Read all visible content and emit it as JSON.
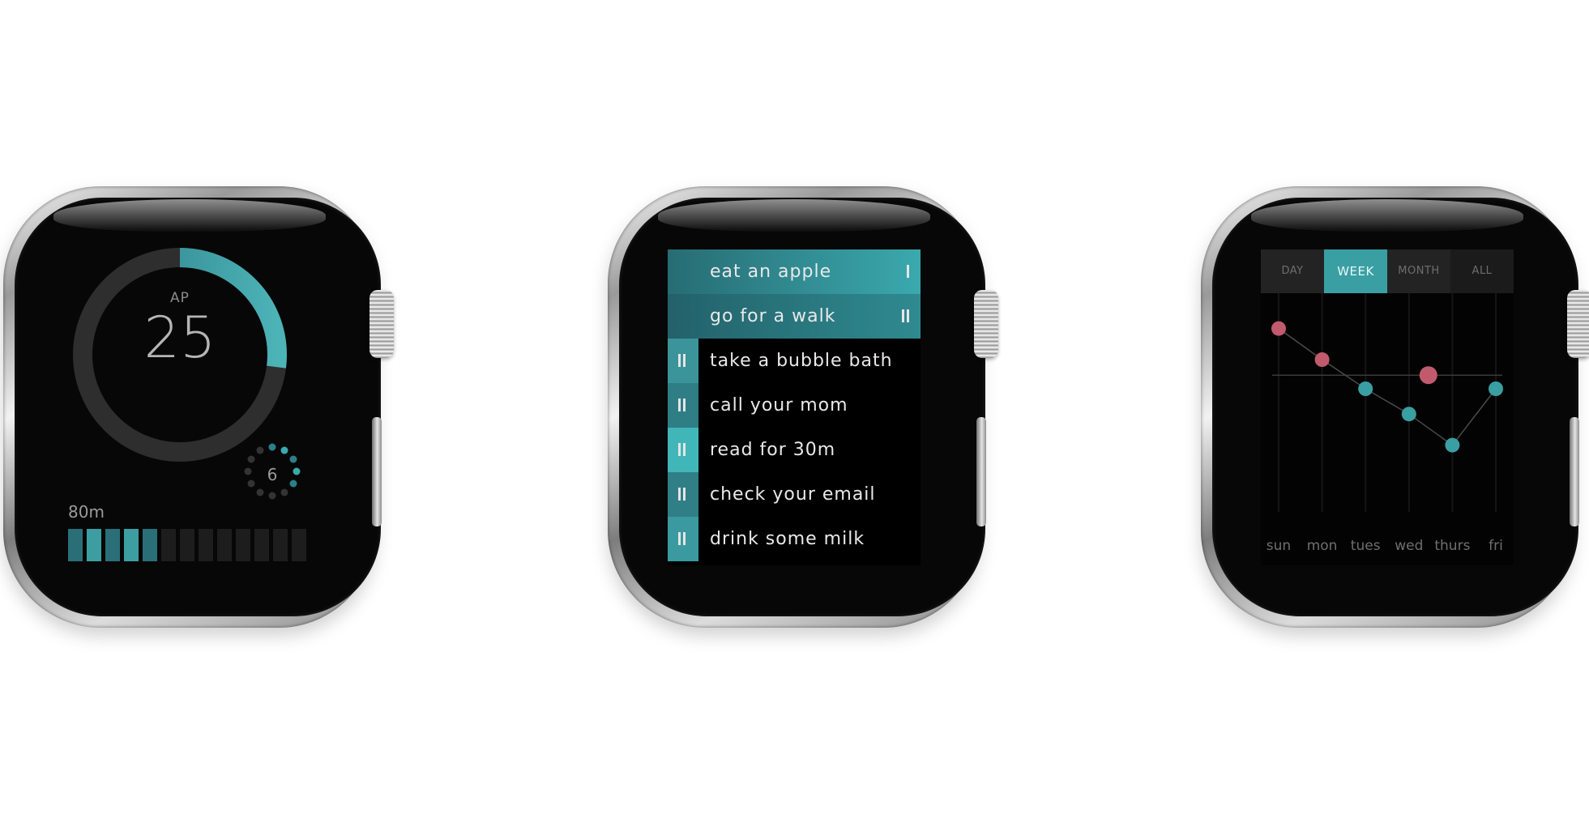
{
  "colors": {
    "accent": "#3a9fa3",
    "accent_dark": "#26707a",
    "pink": "#c25a6e",
    "track": "#2e2e2e",
    "text": "#e9e9e9",
    "muted": "#7a7a7a"
  },
  "watch_timer": {
    "ring_label": "AP",
    "ring_value": "25",
    "ring_progress": 0.27,
    "small_count": "6",
    "small_dots_active": 5,
    "small_dots_total": 12,
    "minutes_label": "80m",
    "bars_filled": 5,
    "bars_total": 13
  },
  "watch_tasks": {
    "tasks": [
      {
        "label": "eat an apple",
        "state": "active",
        "control": "single-bar-icon"
      },
      {
        "label": "go for a walk",
        "state": "active",
        "control": "pause-icon"
      },
      {
        "label": "take a bubble bath",
        "state": "idle"
      },
      {
        "label": "call your mom",
        "state": "idle"
      },
      {
        "label": "read for 30m",
        "state": "idle"
      },
      {
        "label": "check your email",
        "state": "idle"
      },
      {
        "label": "drink some milk",
        "state": "idle"
      }
    ]
  },
  "watch_stats": {
    "segments": [
      {
        "label": "DAY",
        "selected": false
      },
      {
        "label": "WEEK",
        "selected": true
      },
      {
        "label": "MONTH",
        "selected": false
      },
      {
        "label": "ALL",
        "selected": false
      }
    ],
    "chart_data": {
      "type": "scatter",
      "x": [
        "sun",
        "mon",
        "tues",
        "wed",
        "thurs",
        "fri"
      ],
      "line_series": [
        {
          "x": "sun",
          "y": 0.86,
          "color": "pink"
        },
        {
          "x": "mon",
          "y": 0.7,
          "color": "pink"
        },
        {
          "x": "tues",
          "y": 0.55,
          "color": "teal"
        },
        {
          "x": "wed",
          "y": 0.42,
          "color": "teal"
        },
        {
          "x": "thurs",
          "y": 0.26,
          "color": "teal"
        },
        {
          "x": "fri",
          "y": 0.55,
          "color": "teal"
        }
      ],
      "extra_points": [
        {
          "x": "wed",
          "y": 0.62,
          "color": "pink"
        }
      ],
      "reference_line_y": 0.62,
      "ylim": [
        0,
        1
      ],
      "grid": true
    }
  }
}
